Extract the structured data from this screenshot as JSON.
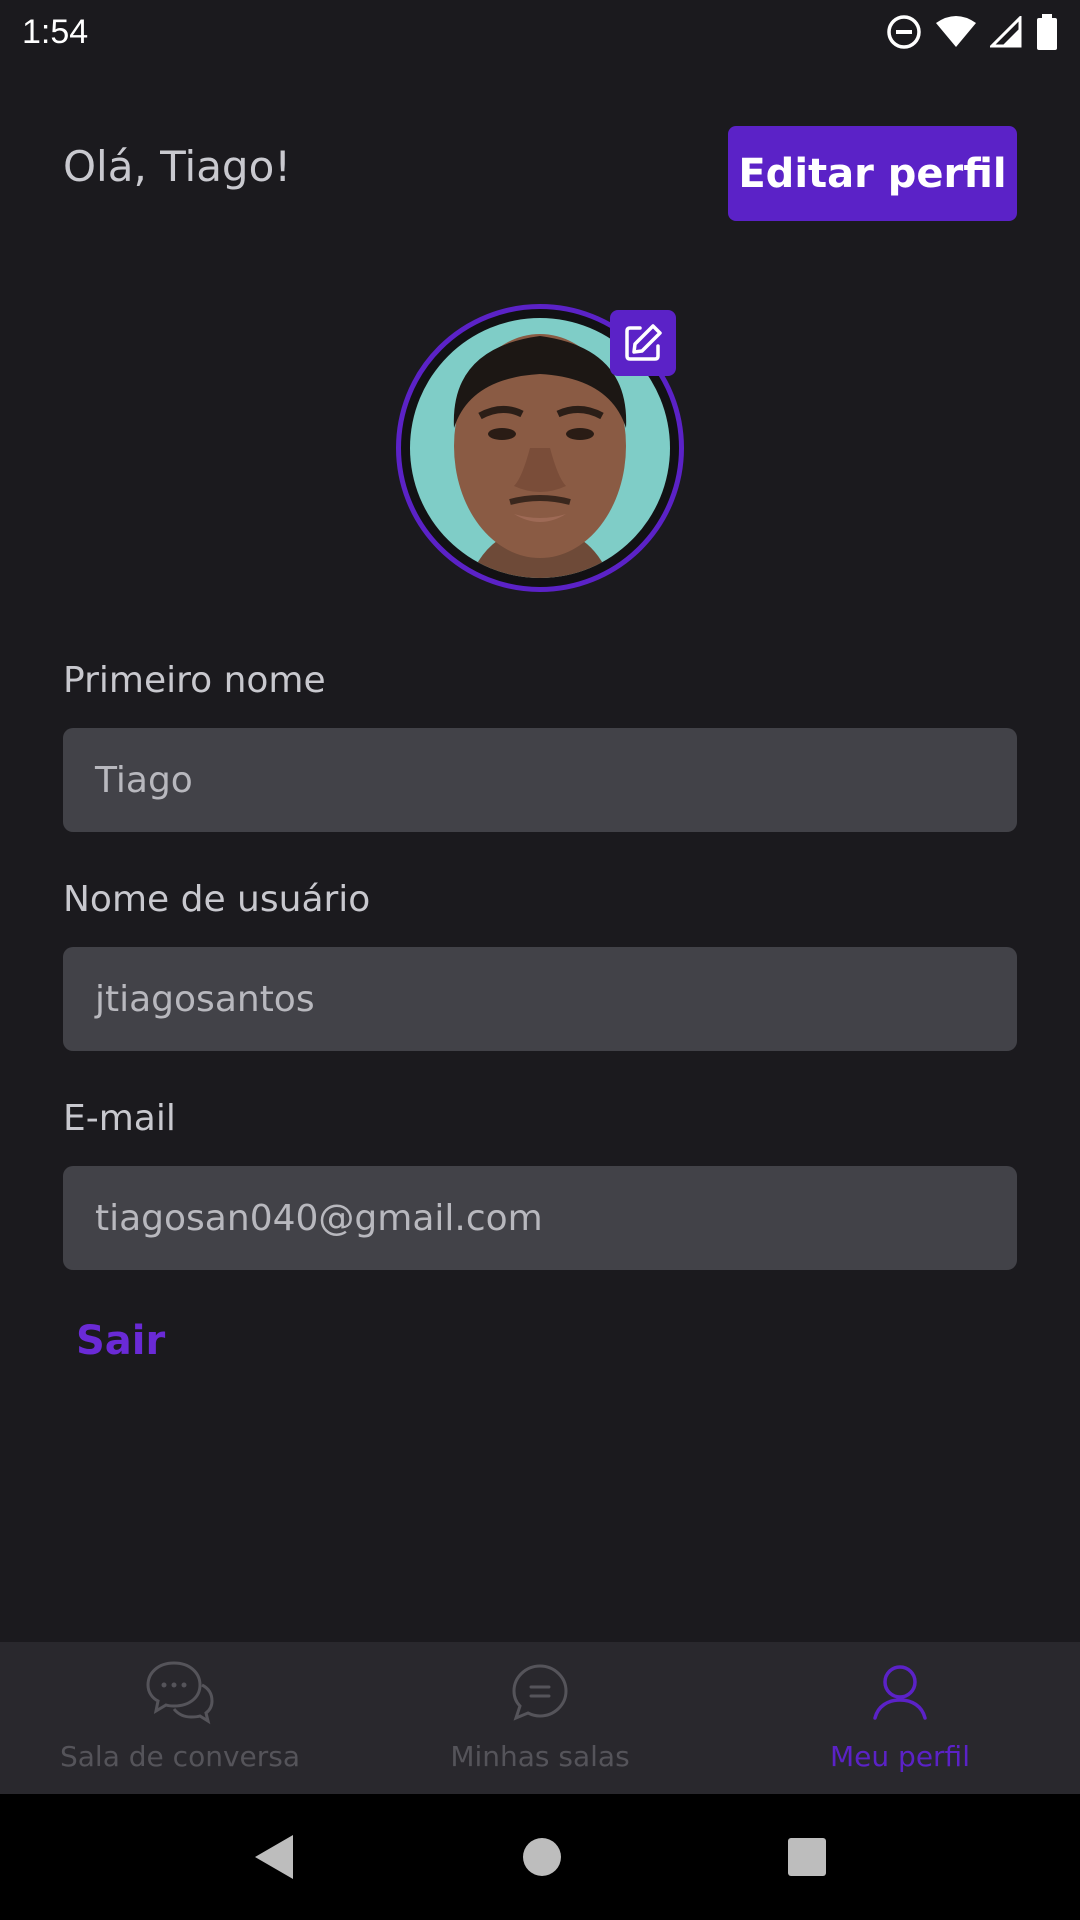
{
  "status_bar": {
    "time": "1:54",
    "icons": [
      "do-not-disturb-icon",
      "wifi-icon",
      "signal-icon",
      "battery-icon"
    ]
  },
  "header": {
    "greeting": "Olá, Tiago!",
    "edit_profile_label": "Editar perfil"
  },
  "profile": {
    "avatar_icon": "avatar",
    "edit_avatar_icon": "edit-icon"
  },
  "form": {
    "first_name": {
      "label": "Primeiro nome",
      "value": "Tiago"
    },
    "username": {
      "label": "Nome de usuário",
      "value": "jtiagosantos"
    },
    "email": {
      "label": "E-mail",
      "value": "tiagosan040@gmail.com"
    }
  },
  "logout_label": "Sair",
  "bottom_nav": {
    "items": [
      {
        "label": "Sala de conversa",
        "icon": "chat-bubbles-icon",
        "active": false
      },
      {
        "label": "Minhas salas",
        "icon": "chat-rooms-icon",
        "active": false
      },
      {
        "label": "Meu perfil",
        "icon": "user-icon",
        "active": true
      }
    ]
  },
  "colors": {
    "background": "#1b1a1e",
    "accent": "#5b22c7",
    "input_bg": "#424248",
    "nav_bg": "#29282d",
    "nav_inactive": "#55545a"
  },
  "system_nav": {
    "icons": [
      "back-icon",
      "home-icon",
      "recents-icon"
    ]
  }
}
